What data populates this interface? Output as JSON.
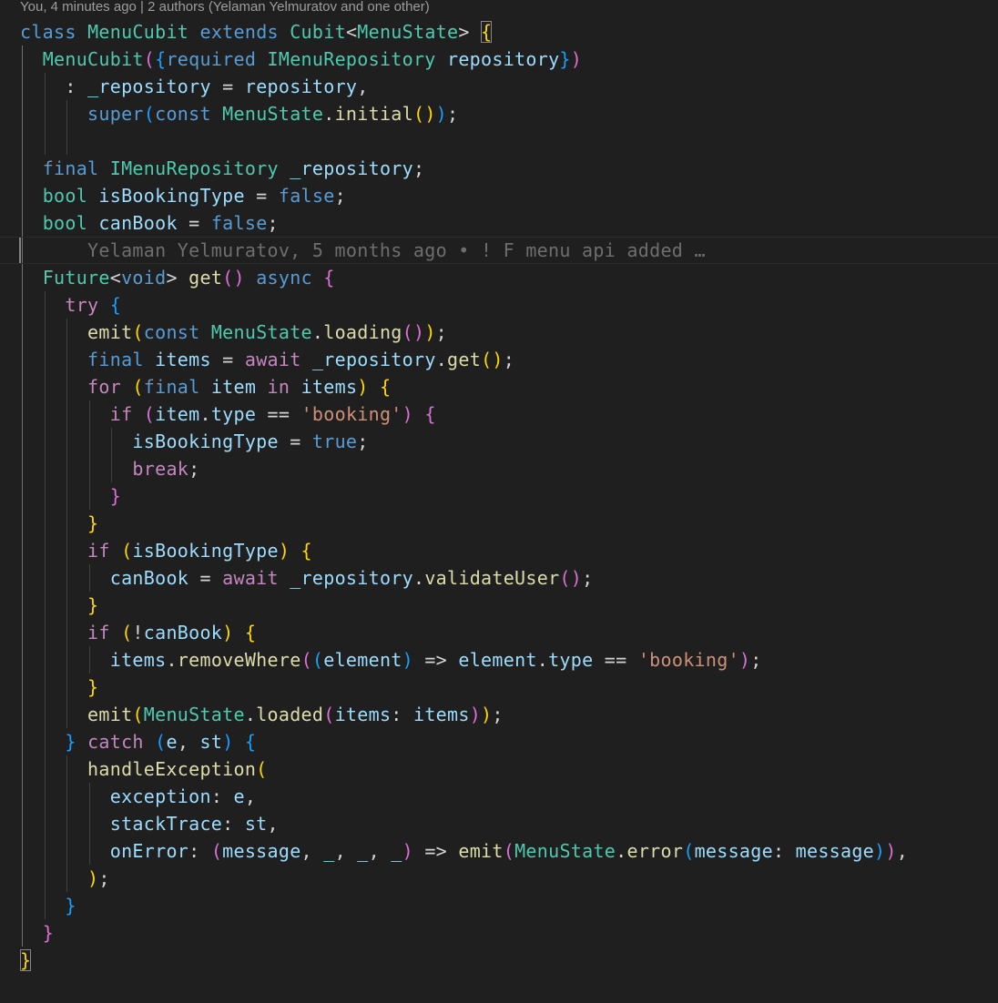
{
  "codelens": "You, 4 minutes ago | 2 authors (Yelaman Yelmuratov and one other)",
  "colors": {
    "background": "#1f1f1f",
    "keyword": "#569cd6",
    "control": "#c586c0",
    "type": "#4ec9b0",
    "function": "#dcdcaa",
    "variable": "#9cdcfe",
    "string": "#ce9178",
    "punctuation": "#d4d4d4",
    "bracket_gold": "#ffd700",
    "bracket_purple": "#da70d6",
    "bracket_blue": "#179fff",
    "blame": "#6e6e6e",
    "indent_guide": "#404040"
  },
  "lines": [
    {
      "indent": 0,
      "tokens": [
        {
          "t": "class",
          "c": "keyword"
        },
        {
          "t": " ",
          "c": "punctuation"
        },
        {
          "t": "MenuCubit",
          "c": "type"
        },
        {
          "t": " ",
          "c": "punctuation"
        },
        {
          "t": "extends",
          "c": "keyword"
        },
        {
          "t": " ",
          "c": "punctuation"
        },
        {
          "t": "Cubit",
          "c": "type"
        },
        {
          "t": "<",
          "c": "punctuation"
        },
        {
          "t": "MenuState",
          "c": "type"
        },
        {
          "t": "> ",
          "c": "punctuation"
        },
        {
          "t": "{",
          "c": "bracket_gold",
          "m": true
        }
      ]
    },
    {
      "indent": 1,
      "tokens": [
        {
          "t": "MenuCubit",
          "c": "type"
        },
        {
          "t": "(",
          "c": "bracket_purple"
        },
        {
          "t": "{",
          "c": "bracket_blue"
        },
        {
          "t": "required",
          "c": "keyword"
        },
        {
          "t": " ",
          "c": "punctuation"
        },
        {
          "t": "IMenuRepository",
          "c": "type"
        },
        {
          "t": " ",
          "c": "punctuation"
        },
        {
          "t": "repository",
          "c": "variable"
        },
        {
          "t": "}",
          "c": "bracket_blue"
        },
        {
          "t": ")",
          "c": "bracket_purple"
        }
      ]
    },
    {
      "indent": 2,
      "tokens": [
        {
          "t": ": ",
          "c": "punctuation"
        },
        {
          "t": "_repository",
          "c": "variable"
        },
        {
          "t": " = ",
          "c": "punctuation"
        },
        {
          "t": "repository",
          "c": "variable"
        },
        {
          "t": ",",
          "c": "punctuation"
        }
      ]
    },
    {
      "indent": 3,
      "tokens": [
        {
          "t": "super",
          "c": "keyword"
        },
        {
          "t": "(",
          "c": "bracket_blue"
        },
        {
          "t": "const",
          "c": "keyword"
        },
        {
          "t": " ",
          "c": "punctuation"
        },
        {
          "t": "MenuState",
          "c": "type"
        },
        {
          "t": ".",
          "c": "punctuation"
        },
        {
          "t": "initial",
          "c": "function"
        },
        {
          "t": "()",
          "c": "bracket_gold"
        },
        {
          "t": ")",
          "c": "bracket_blue"
        },
        {
          "t": ";",
          "c": "punctuation"
        }
      ]
    },
    {
      "indent": 0,
      "tokens": []
    },
    {
      "indent": 1,
      "tokens": [
        {
          "t": "final",
          "c": "keyword"
        },
        {
          "t": " ",
          "c": "punctuation"
        },
        {
          "t": "IMenuRepository",
          "c": "type"
        },
        {
          "t": " ",
          "c": "punctuation"
        },
        {
          "t": "_repository",
          "c": "variable"
        },
        {
          "t": ";",
          "c": "punctuation"
        }
      ]
    },
    {
      "indent": 1,
      "tokens": [
        {
          "t": "bool",
          "c": "type"
        },
        {
          "t": " ",
          "c": "punctuation"
        },
        {
          "t": "isBookingType",
          "c": "variable"
        },
        {
          "t": " = ",
          "c": "punctuation"
        },
        {
          "t": "false",
          "c": "keyword"
        },
        {
          "t": ";",
          "c": "punctuation"
        }
      ]
    },
    {
      "indent": 1,
      "tokens": [
        {
          "t": "bool",
          "c": "type"
        },
        {
          "t": " ",
          "c": "punctuation"
        },
        {
          "t": "canBook",
          "c": "variable"
        },
        {
          "t": " = ",
          "c": "punctuation"
        },
        {
          "t": "false",
          "c": "keyword"
        },
        {
          "t": ";",
          "c": "punctuation"
        }
      ]
    },
    {
      "indent": 3,
      "current": true,
      "tokens": [
        {
          "t": "Yelaman Yelmuratov, 5 months ago • ! F menu api added …",
          "c": "blame"
        }
      ]
    },
    {
      "indent": 1,
      "tokens": [
        {
          "t": "Future",
          "c": "type"
        },
        {
          "t": "<",
          "c": "punctuation"
        },
        {
          "t": "void",
          "c": "keyword"
        },
        {
          "t": "> ",
          "c": "punctuation"
        },
        {
          "t": "get",
          "c": "function"
        },
        {
          "t": "()",
          "c": "bracket_purple"
        },
        {
          "t": " ",
          "c": "punctuation"
        },
        {
          "t": "async",
          "c": "keyword"
        },
        {
          "t": " ",
          "c": "punctuation"
        },
        {
          "t": "{",
          "c": "bracket_purple"
        }
      ]
    },
    {
      "indent": 2,
      "tokens": [
        {
          "t": "try",
          "c": "control"
        },
        {
          "t": " ",
          "c": "punctuation"
        },
        {
          "t": "{",
          "c": "bracket_blue"
        }
      ]
    },
    {
      "indent": 3,
      "tokens": [
        {
          "t": "emit",
          "c": "function"
        },
        {
          "t": "(",
          "c": "bracket_gold"
        },
        {
          "t": "const",
          "c": "keyword"
        },
        {
          "t": " ",
          "c": "punctuation"
        },
        {
          "t": "MenuState",
          "c": "type"
        },
        {
          "t": ".",
          "c": "punctuation"
        },
        {
          "t": "loading",
          "c": "function"
        },
        {
          "t": "()",
          "c": "bracket_purple"
        },
        {
          "t": ")",
          "c": "bracket_gold"
        },
        {
          "t": ";",
          "c": "punctuation"
        }
      ]
    },
    {
      "indent": 3,
      "tokens": [
        {
          "t": "final",
          "c": "keyword"
        },
        {
          "t": " ",
          "c": "punctuation"
        },
        {
          "t": "items",
          "c": "variable"
        },
        {
          "t": " = ",
          "c": "punctuation"
        },
        {
          "t": "await",
          "c": "control"
        },
        {
          "t": " ",
          "c": "punctuation"
        },
        {
          "t": "_repository",
          "c": "variable"
        },
        {
          "t": ".",
          "c": "punctuation"
        },
        {
          "t": "get",
          "c": "function"
        },
        {
          "t": "()",
          "c": "bracket_gold"
        },
        {
          "t": ";",
          "c": "punctuation"
        }
      ]
    },
    {
      "indent": 3,
      "tokens": [
        {
          "t": "for",
          "c": "control"
        },
        {
          "t": " ",
          "c": "punctuation"
        },
        {
          "t": "(",
          "c": "bracket_gold"
        },
        {
          "t": "final",
          "c": "keyword"
        },
        {
          "t": " ",
          "c": "punctuation"
        },
        {
          "t": "item",
          "c": "variable"
        },
        {
          "t": " ",
          "c": "punctuation"
        },
        {
          "t": "in",
          "c": "control"
        },
        {
          "t": " ",
          "c": "punctuation"
        },
        {
          "t": "items",
          "c": "variable"
        },
        {
          "t": ")",
          "c": "bracket_gold"
        },
        {
          "t": " ",
          "c": "punctuation"
        },
        {
          "t": "{",
          "c": "bracket_gold"
        }
      ]
    },
    {
      "indent": 4,
      "tokens": [
        {
          "t": "if",
          "c": "control"
        },
        {
          "t": " ",
          "c": "punctuation"
        },
        {
          "t": "(",
          "c": "bracket_purple"
        },
        {
          "t": "item",
          "c": "variable"
        },
        {
          "t": ".",
          "c": "punctuation"
        },
        {
          "t": "type",
          "c": "variable"
        },
        {
          "t": " == ",
          "c": "punctuation"
        },
        {
          "t": "'booking'",
          "c": "string"
        },
        {
          "t": ")",
          "c": "bracket_purple"
        },
        {
          "t": " ",
          "c": "punctuation"
        },
        {
          "t": "{",
          "c": "bracket_purple"
        }
      ]
    },
    {
      "indent": 5,
      "tokens": [
        {
          "t": "isBookingType",
          "c": "variable"
        },
        {
          "t": " = ",
          "c": "punctuation"
        },
        {
          "t": "true",
          "c": "keyword"
        },
        {
          "t": ";",
          "c": "punctuation"
        }
      ]
    },
    {
      "indent": 5,
      "tokens": [
        {
          "t": "break",
          "c": "control"
        },
        {
          "t": ";",
          "c": "punctuation"
        }
      ]
    },
    {
      "indent": 4,
      "tokens": [
        {
          "t": "}",
          "c": "bracket_purple"
        }
      ]
    },
    {
      "indent": 3,
      "tokens": [
        {
          "t": "}",
          "c": "bracket_gold"
        }
      ]
    },
    {
      "indent": 3,
      "tokens": [
        {
          "t": "if",
          "c": "control"
        },
        {
          "t": " ",
          "c": "punctuation"
        },
        {
          "t": "(",
          "c": "bracket_gold"
        },
        {
          "t": "isBookingType",
          "c": "variable"
        },
        {
          "t": ")",
          "c": "bracket_gold"
        },
        {
          "t": " ",
          "c": "punctuation"
        },
        {
          "t": "{",
          "c": "bracket_gold"
        }
      ]
    },
    {
      "indent": 4,
      "tokens": [
        {
          "t": "canBook",
          "c": "variable"
        },
        {
          "t": " = ",
          "c": "punctuation"
        },
        {
          "t": "await",
          "c": "control"
        },
        {
          "t": " ",
          "c": "punctuation"
        },
        {
          "t": "_repository",
          "c": "variable"
        },
        {
          "t": ".",
          "c": "punctuation"
        },
        {
          "t": "validateUser",
          "c": "function"
        },
        {
          "t": "()",
          "c": "bracket_purple"
        },
        {
          "t": ";",
          "c": "punctuation"
        }
      ]
    },
    {
      "indent": 3,
      "tokens": [
        {
          "t": "}",
          "c": "bracket_gold"
        }
      ]
    },
    {
      "indent": 3,
      "tokens": [
        {
          "t": "if",
          "c": "control"
        },
        {
          "t": " ",
          "c": "punctuation"
        },
        {
          "t": "(",
          "c": "bracket_gold"
        },
        {
          "t": "!",
          "c": "punctuation"
        },
        {
          "t": "canBook",
          "c": "variable"
        },
        {
          "t": ")",
          "c": "bracket_gold"
        },
        {
          "t": " ",
          "c": "punctuation"
        },
        {
          "t": "{",
          "c": "bracket_gold"
        }
      ]
    },
    {
      "indent": 4,
      "tokens": [
        {
          "t": "items",
          "c": "variable"
        },
        {
          "t": ".",
          "c": "punctuation"
        },
        {
          "t": "removeWhere",
          "c": "function"
        },
        {
          "t": "(",
          "c": "bracket_purple"
        },
        {
          "t": "(",
          "c": "bracket_blue"
        },
        {
          "t": "element",
          "c": "variable"
        },
        {
          "t": ")",
          "c": "bracket_blue"
        },
        {
          "t": " => ",
          "c": "punctuation"
        },
        {
          "t": "element",
          "c": "variable"
        },
        {
          "t": ".",
          "c": "punctuation"
        },
        {
          "t": "type",
          "c": "variable"
        },
        {
          "t": " == ",
          "c": "punctuation"
        },
        {
          "t": "'booking'",
          "c": "string"
        },
        {
          "t": ")",
          "c": "bracket_purple"
        },
        {
          "t": ";",
          "c": "punctuation"
        }
      ]
    },
    {
      "indent": 3,
      "tokens": [
        {
          "t": "}",
          "c": "bracket_gold"
        }
      ]
    },
    {
      "indent": 3,
      "tokens": [
        {
          "t": "emit",
          "c": "function"
        },
        {
          "t": "(",
          "c": "bracket_gold"
        },
        {
          "t": "MenuState",
          "c": "type"
        },
        {
          "t": ".",
          "c": "punctuation"
        },
        {
          "t": "loaded",
          "c": "function"
        },
        {
          "t": "(",
          "c": "bracket_purple"
        },
        {
          "t": "items",
          "c": "variable"
        },
        {
          "t": ": ",
          "c": "punctuation"
        },
        {
          "t": "items",
          "c": "variable"
        },
        {
          "t": ")",
          "c": "bracket_purple"
        },
        {
          "t": ")",
          "c": "bracket_gold"
        },
        {
          "t": ";",
          "c": "punctuation"
        }
      ]
    },
    {
      "indent": 2,
      "tokens": [
        {
          "t": "}",
          "c": "bracket_blue"
        },
        {
          "t": " ",
          "c": "punctuation"
        },
        {
          "t": "catch",
          "c": "control"
        },
        {
          "t": " ",
          "c": "punctuation"
        },
        {
          "t": "(",
          "c": "bracket_blue"
        },
        {
          "t": "e",
          "c": "variable"
        },
        {
          "t": ", ",
          "c": "punctuation"
        },
        {
          "t": "st",
          "c": "variable"
        },
        {
          "t": ")",
          "c": "bracket_blue"
        },
        {
          "t": " ",
          "c": "punctuation"
        },
        {
          "t": "{",
          "c": "bracket_blue"
        }
      ]
    },
    {
      "indent": 3,
      "tokens": [
        {
          "t": "handleException",
          "c": "function"
        },
        {
          "t": "(",
          "c": "bracket_gold"
        }
      ]
    },
    {
      "indent": 4,
      "tokens": [
        {
          "t": "exception",
          "c": "variable"
        },
        {
          "t": ": ",
          "c": "punctuation"
        },
        {
          "t": "e",
          "c": "variable"
        },
        {
          "t": ",",
          "c": "punctuation"
        }
      ]
    },
    {
      "indent": 4,
      "tokens": [
        {
          "t": "stackTrace",
          "c": "variable"
        },
        {
          "t": ": ",
          "c": "punctuation"
        },
        {
          "t": "st",
          "c": "variable"
        },
        {
          "t": ",",
          "c": "punctuation"
        }
      ]
    },
    {
      "indent": 4,
      "tokens": [
        {
          "t": "onError",
          "c": "variable"
        },
        {
          "t": ": ",
          "c": "punctuation"
        },
        {
          "t": "(",
          "c": "bracket_purple"
        },
        {
          "t": "message",
          "c": "variable"
        },
        {
          "t": ", ",
          "c": "punctuation"
        },
        {
          "t": "_",
          "c": "variable"
        },
        {
          "t": ", ",
          "c": "punctuation"
        },
        {
          "t": "_",
          "c": "variable"
        },
        {
          "t": ", ",
          "c": "punctuation"
        },
        {
          "t": "_",
          "c": "variable"
        },
        {
          "t": ")",
          "c": "bracket_purple"
        },
        {
          "t": " => ",
          "c": "punctuation"
        },
        {
          "t": "emit",
          "c": "function"
        },
        {
          "t": "(",
          "c": "bracket_purple"
        },
        {
          "t": "MenuState",
          "c": "type"
        },
        {
          "t": ".",
          "c": "punctuation"
        },
        {
          "t": "error",
          "c": "function"
        },
        {
          "t": "(",
          "c": "bracket_blue"
        },
        {
          "t": "message",
          "c": "variable"
        },
        {
          "t": ": ",
          "c": "punctuation"
        },
        {
          "t": "message",
          "c": "variable"
        },
        {
          "t": ")",
          "c": "bracket_blue"
        },
        {
          "t": ")",
          "c": "bracket_purple"
        },
        {
          "t": ",",
          "c": "punctuation"
        }
      ]
    },
    {
      "indent": 3,
      "tokens": [
        {
          "t": ")",
          "c": "bracket_gold"
        },
        {
          "t": ";",
          "c": "punctuation"
        }
      ]
    },
    {
      "indent": 2,
      "tokens": [
        {
          "t": "}",
          "c": "bracket_blue"
        }
      ]
    },
    {
      "indent": 1,
      "tokens": [
        {
          "t": "}",
          "c": "bracket_purple"
        }
      ]
    },
    {
      "indent": 0,
      "tokens": [
        {
          "t": "}",
          "c": "bracket_gold",
          "m": true
        }
      ]
    }
  ]
}
